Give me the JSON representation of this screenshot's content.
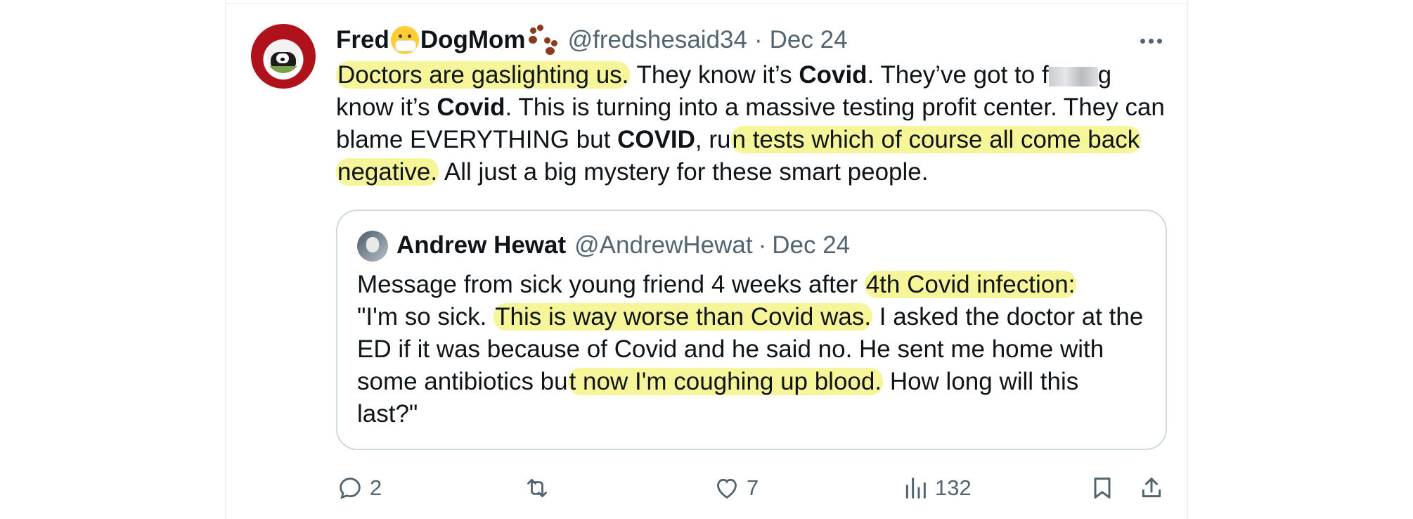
{
  "tweet": {
    "author_name_part1": "Fred",
    "author_name_part2": "DogMom",
    "handle": "@fredshesaid34",
    "separator": "·",
    "date": "Dec 24",
    "lines": [
      [
        "Doctors are gaslighting us.",
        " They know it’s ",
        "Covid",
        ". They’ve got to f",
        "",
        "g"
      ],
      [
        "know it’s ",
        "Covid",
        ". This is turning into a massive testing profit center. They can"
      ],
      [
        "blame EVERYTHING but ",
        "COVID",
        ", ru",
        "n tests which of course all come back"
      ],
      [
        "negative.",
        " All just a big mystery for these smart people."
      ]
    ]
  },
  "quoted": {
    "author_name": "Andrew Hewat",
    "handle": "@AndrewHewat",
    "separator": "·",
    "date": "Dec 24",
    "lines": [
      [
        "Message from sick young friend 4 weeks after ",
        "4th Covid infection:"
      ],
      [
        "\"I'm so sick. ",
        "This is way worse than Covid was.",
        " I asked the doctor at the"
      ],
      [
        "ED if it was because of Covid and he said no. He sent me home with"
      ],
      [
        "some antibiotics bu",
        "t now I'm coughing up blood.",
        " How long will this"
      ],
      [
        "last?\""
      ]
    ]
  },
  "actions": {
    "replies": "2",
    "retweets": "",
    "likes": "7",
    "views": "132"
  },
  "colors": {
    "highlight": "#f6f59a",
    "secondary_text": "#536471",
    "border": "#cfd9de"
  },
  "icons": [
    "more-icon",
    "reply-icon",
    "retweet-icon",
    "like-icon",
    "views-icon",
    "bookmark-icon",
    "share-icon"
  ]
}
